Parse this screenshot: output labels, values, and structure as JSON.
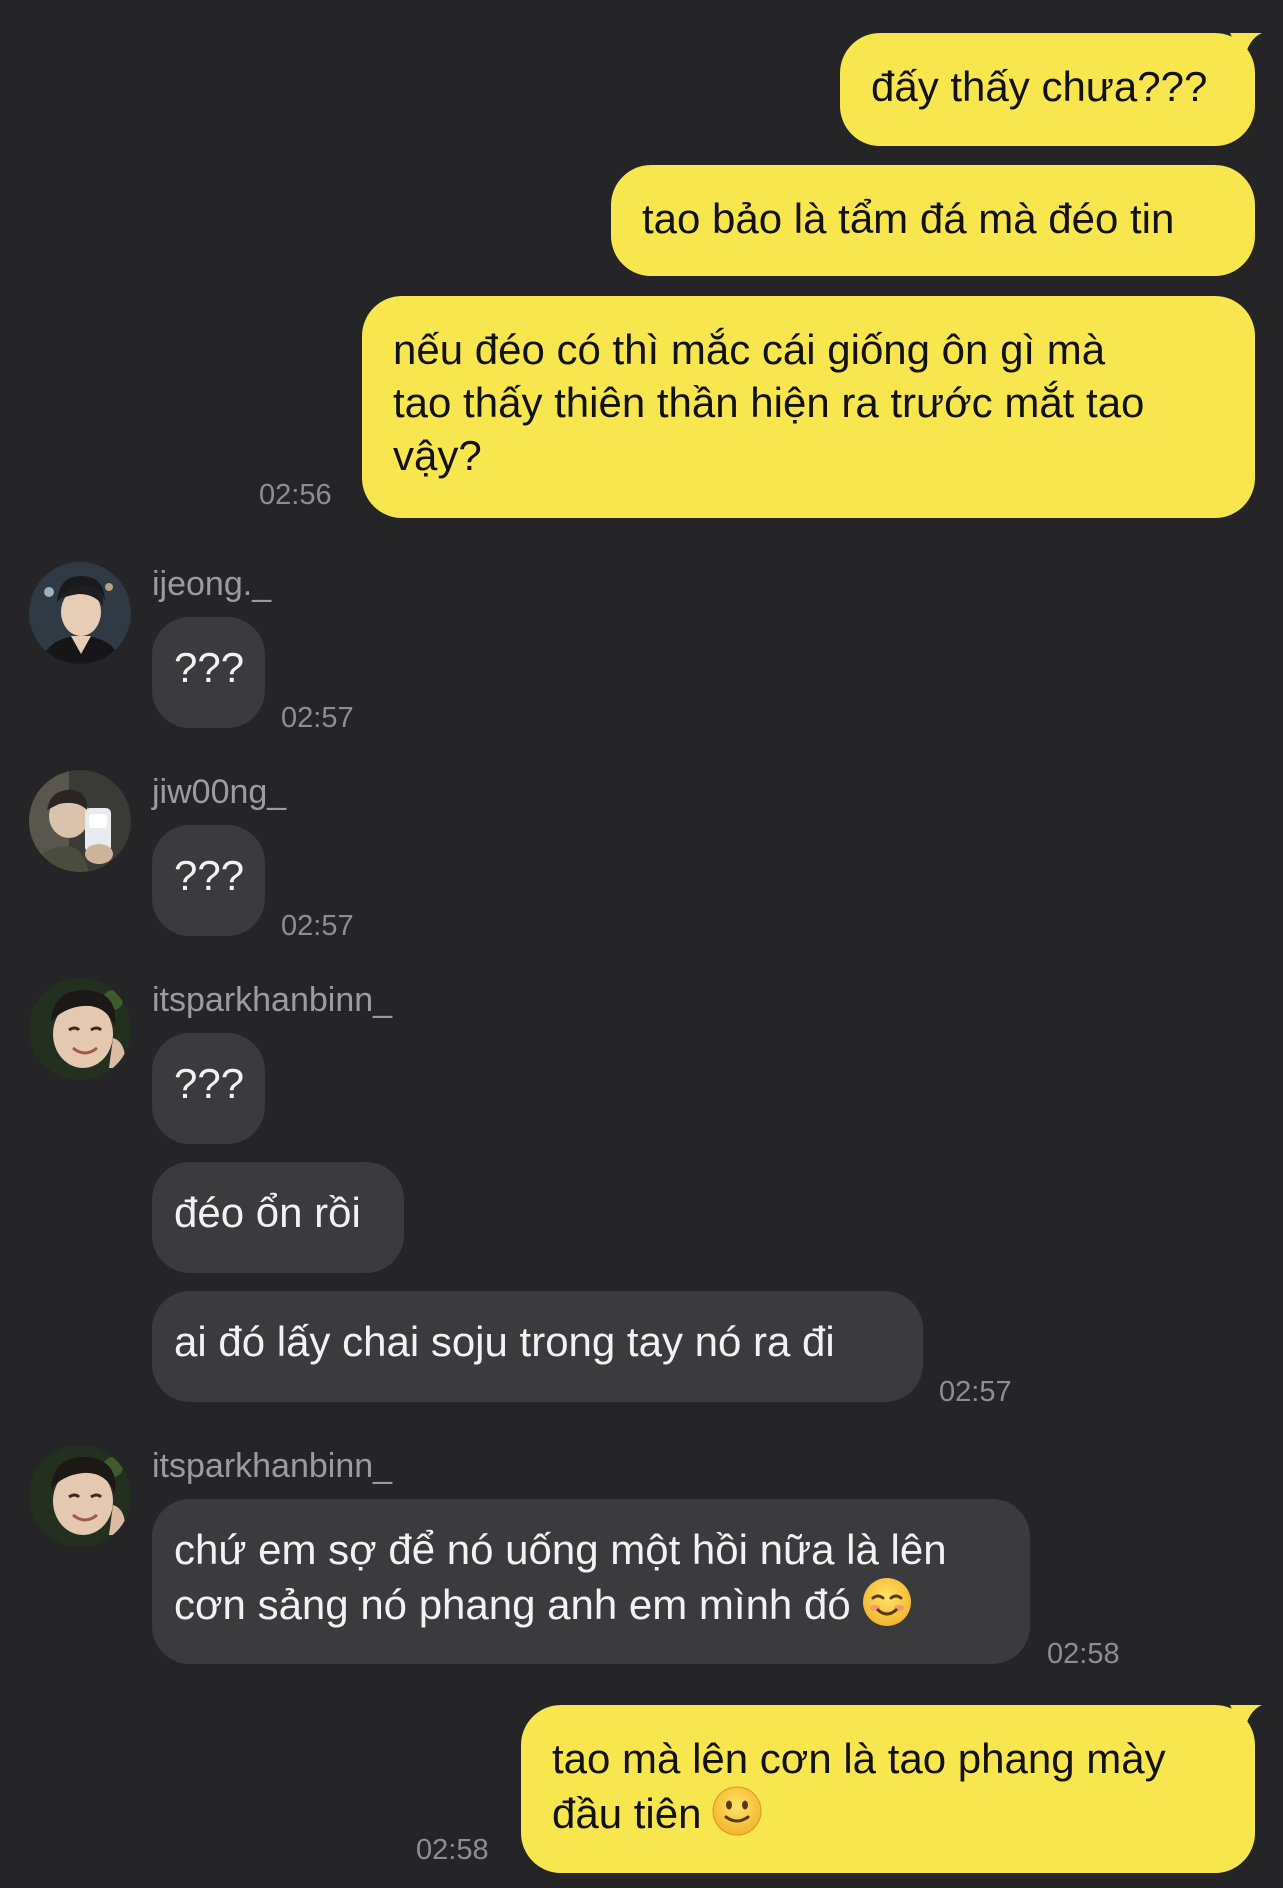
{
  "colors": {
    "background": "#252527",
    "outgoing_bubble": "#f8e64f",
    "incoming_bubble": "#3b3b3d",
    "timestamp": "#8e8e92",
    "username": "#9c9ca0"
  },
  "messages": {
    "m1": {
      "sender": "me",
      "text": "đấy thấy chưa???"
    },
    "m2": {
      "sender": "me",
      "text": "tao bảo là tẩm đá mà đéo tin"
    },
    "m3": {
      "sender": "me",
      "lines": [
        "nếu đéo có thì mắc cái giống ôn gì mà",
        "tao thấy thiên thần hiện ra trước mắt tao",
        "vậy?"
      ],
      "time": "02:56"
    },
    "g1": {
      "user": "ijeong._",
      "text": "???",
      "time": "02:57"
    },
    "g2": {
      "user": "jiw00ng_",
      "text": "???",
      "time": "02:57"
    },
    "g3": {
      "user": "itsparkhanbinn_",
      "msg1": "???",
      "msg2": "đéo ổn rồi",
      "msg3": "ai đó lấy chai soju trong tay nó ra đi",
      "time": "02:57"
    },
    "g4": {
      "user": "itsparkhanbinn_",
      "lines": [
        "chứ em sợ để nó uống một hồi nữa là lên",
        "cơn sảng nó phang anh em mình đó"
      ],
      "emoji": "smiling-face-icon",
      "time": "02:58"
    },
    "m4": {
      "sender": "me",
      "lines": [
        "tao mà lên cơn là tao phang mày",
        "đầu tiên"
      ],
      "emoji": "slightly-smiling-face-icon",
      "time": "02:58"
    }
  }
}
